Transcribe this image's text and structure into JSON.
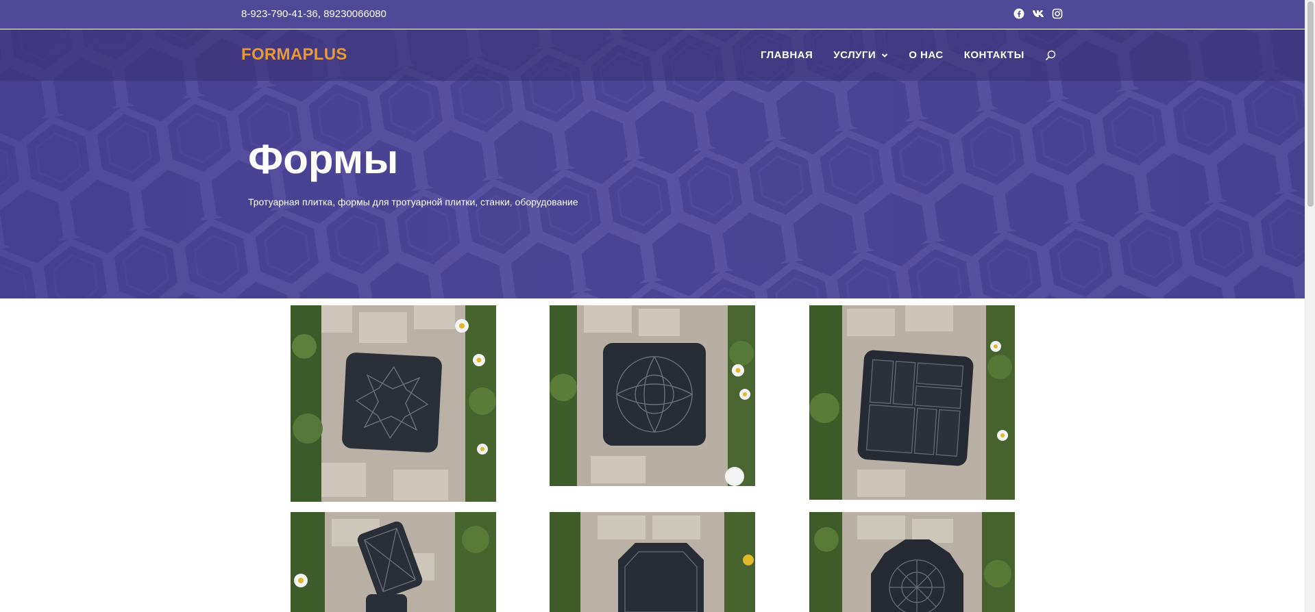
{
  "topbar": {
    "phone": "8-923-790-41-36, 89230066080",
    "social": [
      "facebook-icon",
      "vk-icon",
      "instagram-icon"
    ]
  },
  "header": {
    "logo": "FORMAPLUS",
    "nav": [
      {
        "label": "ГЛАВНАЯ",
        "dropdown": false
      },
      {
        "label": "УСЛУГИ",
        "dropdown": true
      },
      {
        "label": "О НАС",
        "dropdown": false
      },
      {
        "label": "КОНТАКТЫ",
        "dropdown": false
      }
    ],
    "search_icon": "search-icon"
  },
  "hero": {
    "title": "Формы",
    "subtitle": "Тротуарная плитка, формы для тротуарной плитки, станки, оборудование"
  },
  "gallery": {
    "items": [
      {
        "name": "form-star-pattern"
      },
      {
        "name": "form-circle-petal-pattern"
      },
      {
        "name": "form-rectangle-blocks"
      },
      {
        "name": "form-rectangular-ornament"
      },
      {
        "name": "form-hexagon"
      },
      {
        "name": "form-octagon-ornament"
      }
    ]
  },
  "colors": {
    "topbar_bg": "#4f4997",
    "hero_bg": "#4d4691",
    "logo": "#e79a3a",
    "text_light": "#ffffff"
  }
}
